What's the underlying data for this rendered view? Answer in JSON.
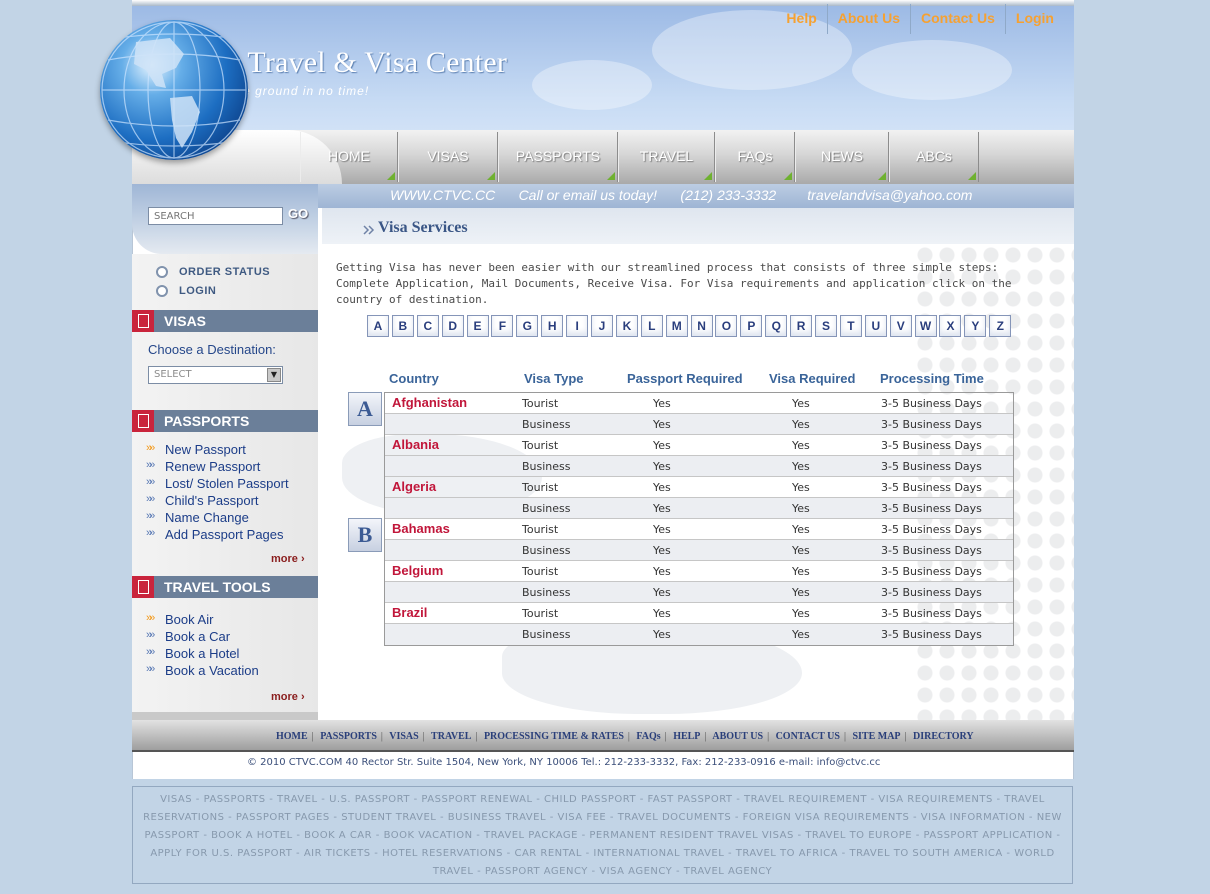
{
  "brand": {
    "title": "Complete Travel & Visa Center",
    "tagline": "We'll get you off the ground in no time!"
  },
  "topnav": [
    "Help",
    "About Us",
    "Contact Us",
    "Login"
  ],
  "mainnav": [
    "HOME",
    "VISAS",
    "PASSPORTS",
    "TRAVEL",
    "FAQs",
    "NEWS",
    "ABCs"
  ],
  "contact_strip": "WWW.CTVC.CC      Call or email us today!      (212) 233-3332        travelandvisa@yahoo.com",
  "search": {
    "placeholder": "SEARCH",
    "go_label": "GO"
  },
  "quick_links": [
    "ORDER STATUS",
    "LOGIN"
  ],
  "sidebar": {
    "visas": {
      "title": "VISAS",
      "choose_label": "Choose a Destination:",
      "select_value": "SELECT"
    },
    "passports": {
      "title": "PASSPORTS",
      "items": [
        "New Passport",
        "Renew Passport",
        "Lost/ Stolen Passport",
        "Child's Passport",
        "Name Change",
        "Add Passport Pages"
      ],
      "more": "more"
    },
    "travel_tools": {
      "title": "TRAVEL TOOLS",
      "items": [
        "Book Air",
        "Book a Car",
        "Book a Hotel",
        "Book a Vacation"
      ],
      "more": "more"
    }
  },
  "section_title": "Visa Services",
  "intro": "Getting Visa has never been easier with our streamlined process that consists of three simple steps: Complete Application, Mail Documents, Receive Visa. For Visa requirements and application click on the country of destination.",
  "alphabet": [
    "A",
    "B",
    "C",
    "D",
    "E",
    "F",
    "G",
    "H",
    "I",
    "J",
    "K",
    "L",
    "M",
    "N",
    "O",
    "P",
    "Q",
    "R",
    "S",
    "T",
    "U",
    "V",
    "W",
    "X",
    "Y",
    "Z"
  ],
  "table": {
    "headers": [
      "Country",
      "Visa Type",
      "Passport Required",
      "Visa Required",
      "Processing Time"
    ],
    "groups": [
      "A",
      "B"
    ],
    "rows": [
      {
        "country": "Afghanistan",
        "type": "Tourist",
        "passport": "Yes",
        "visa": "Yes",
        "time": "3-5 Business Days"
      },
      {
        "country": "",
        "type": "Business",
        "passport": "Yes",
        "visa": "Yes",
        "time": "3-5 Business Days"
      },
      {
        "country": "Albania",
        "type": "Tourist",
        "passport": "Yes",
        "visa": "Yes",
        "time": "3-5 Business Days"
      },
      {
        "country": "",
        "type": "Business",
        "passport": "Yes",
        "visa": "Yes",
        "time": "3-5 Business Days"
      },
      {
        "country": "Algeria",
        "type": "Tourist",
        "passport": "Yes",
        "visa": "Yes",
        "time": "3-5 Business Days"
      },
      {
        "country": "",
        "type": "Business",
        "passport": "Yes",
        "visa": "Yes",
        "time": "3-5 Business Days"
      },
      {
        "country": "Bahamas",
        "type": "Tourist",
        "passport": "Yes",
        "visa": "Yes",
        "time": "3-5 Business Days"
      },
      {
        "country": "",
        "type": "Business",
        "passport": "Yes",
        "visa": "Yes",
        "time": "3-5 Business Days"
      },
      {
        "country": "Belgium",
        "type": "Tourist",
        "passport": "Yes",
        "visa": "Yes",
        "time": "3-5 Business Days"
      },
      {
        "country": "",
        "type": "Business",
        "passport": "Yes",
        "visa": "Yes",
        "time": "3-5 Business Days"
      },
      {
        "country": "Brazil",
        "type": "Tourist",
        "passport": "Yes",
        "visa": "Yes",
        "time": "3-5 Business Days"
      },
      {
        "country": "",
        "type": "Business",
        "passport": "Yes",
        "visa": "Yes",
        "time": "3-5 Business Days"
      }
    ]
  },
  "footer_nav": [
    "HOME",
    "PASSPORTS",
    "VISAS",
    "TRAVEL",
    "PROCESSING TIME & RATES",
    "FAQs",
    "HELP",
    "ABOUT US",
    "CONTACT US",
    "SITE MAP",
    "DIRECTORY"
  ],
  "copyright": "©  2010 CTVC.COM  40 Rector Str. Suite 1504, New York, NY 10006 Tel.: 212-233-3332, Fax: 212-233-0916 e-mail: info@ctvc.cc",
  "keywords": "VISAS - PASSPORTS - TRAVEL - U.S. PASSPORT - PASSPORT RENEWAL - CHILD PASSPORT - FAST PASSPORT - TRAVEL REQUIREMENT - VISA REQUIREMENTS - TRAVEL RESERVATIONS - PASSPORT PAGES - STUDENT TRAVEL - BUSINESS TRAVEL - VISA FEE - TRAVEL DOCUMENTS - FOREIGN VISA REQUIREMENTS - VISA INFORMATION - NEW PASSPORT - BOOK A HOTEL - BOOK A CAR - BOOK VACATION - TRAVEL PACKAGE - PERMANENT RESIDENT TRAVEL VISAS - TRAVEL TO EUROPE - PASSPORT APPLICATION - APPLY FOR U.S. PASSPORT - AIR TICKETS - HOTEL RESERVATIONS - CAR RENTAL - INTERNATIONAL TRAVEL - TRAVEL TO AFRICA - TRAVEL TO SOUTH AMERICA - WORLD TRAVEL - PASSPORT AGENCY - VISA AGENCY - TRAVEL AGENCY"
}
